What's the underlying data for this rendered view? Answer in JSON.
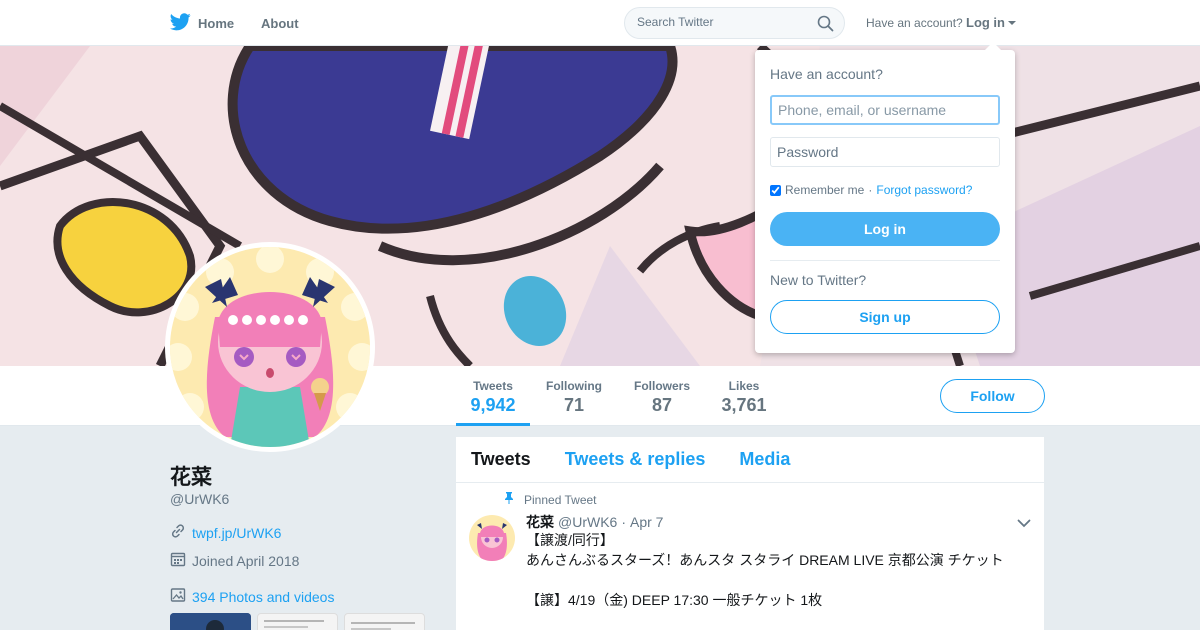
{
  "nav": {
    "home_label": "Home",
    "about_label": "About",
    "search_placeholder": "Search Twitter",
    "have_account": "Have an account?",
    "login_label": "Log in"
  },
  "profile_nav": {
    "stats": [
      {
        "label": "Tweets",
        "value": "9,942"
      },
      {
        "label": "Following",
        "value": "71"
      },
      {
        "label": "Followers",
        "value": "87"
      },
      {
        "label": "Likes",
        "value": "3,761"
      }
    ],
    "follow_label": "Follow"
  },
  "profile": {
    "name": "花菜",
    "handle": "@UrWK6",
    "url": "twpf.jp/UrWK6",
    "joined": "Joined April 2018",
    "photos": "394 Photos and videos"
  },
  "timeline": {
    "tabs": [
      "Tweets",
      "Tweets & replies",
      "Media"
    ],
    "tweet": {
      "pinned_label": "Pinned Tweet",
      "name": "花菜",
      "handle": "@UrWK6",
      "separator": "·",
      "date": "Apr 7",
      "lines": [
        "【譲渡/同行】",
        "あんさんぶるスターズ！あんスタ スタライ DREAM LIVE 京都公演 チケット",
        "【譲】4/19（金) DEEP 17:30 一般チケット 1枚"
      ]
    }
  },
  "login_dropdown": {
    "title": "Have an account?",
    "username_placeholder": "Phone, email, or username",
    "password_placeholder": "Password",
    "remember_label": "Remember me",
    "separator": "·",
    "forgot_label": "Forgot password?",
    "login_button": "Log in",
    "new_label": "New to Twitter?",
    "signup_button": "Sign up"
  },
  "colors": {
    "accent": "#1da1f2",
    "login_button": "#4ab3f4",
    "page_background": "#e6ecf0"
  }
}
